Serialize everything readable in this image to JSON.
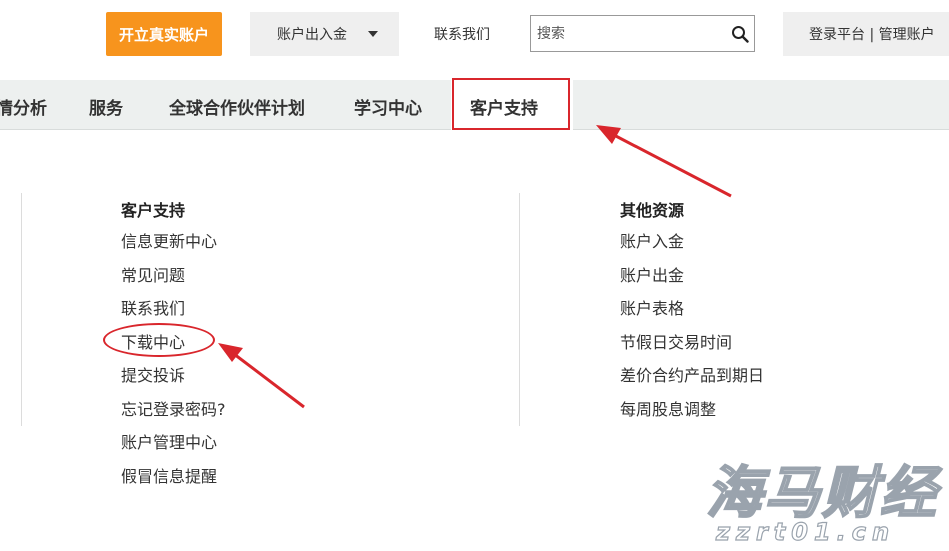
{
  "topbar": {
    "open_account": "开立真实账户",
    "funds_dropdown": "账户出入金",
    "contact": "联系我们",
    "search_placeholder": "搜索",
    "login": "登录平台 | 管理账户"
  },
  "nav": {
    "items": [
      "情分析",
      "服务",
      "全球合作伙伴计划",
      "学习中心",
      "客户支持"
    ],
    "active": "客户支持"
  },
  "columns": [
    {
      "title": "客户支持",
      "links": [
        "信息更新中心",
        "常见问题",
        "联系我们",
        "下载中心",
        "提交投诉",
        "忘记登录密码?",
        "账户管理中心",
        "假冒信息提醒"
      ]
    },
    {
      "title": "其他资源",
      "links": [
        "账户入金",
        "账户出金",
        "账户表格",
        "节假日交易时间",
        "差价合约产品到期日",
        "每周股息调整"
      ]
    }
  ],
  "watermark": {
    "name": "海马财经",
    "url": "zzrt01.cn"
  },
  "colors": {
    "accent": "#f7941d",
    "annotation": "#d9262c",
    "nav_bg": "#edf0ef"
  }
}
